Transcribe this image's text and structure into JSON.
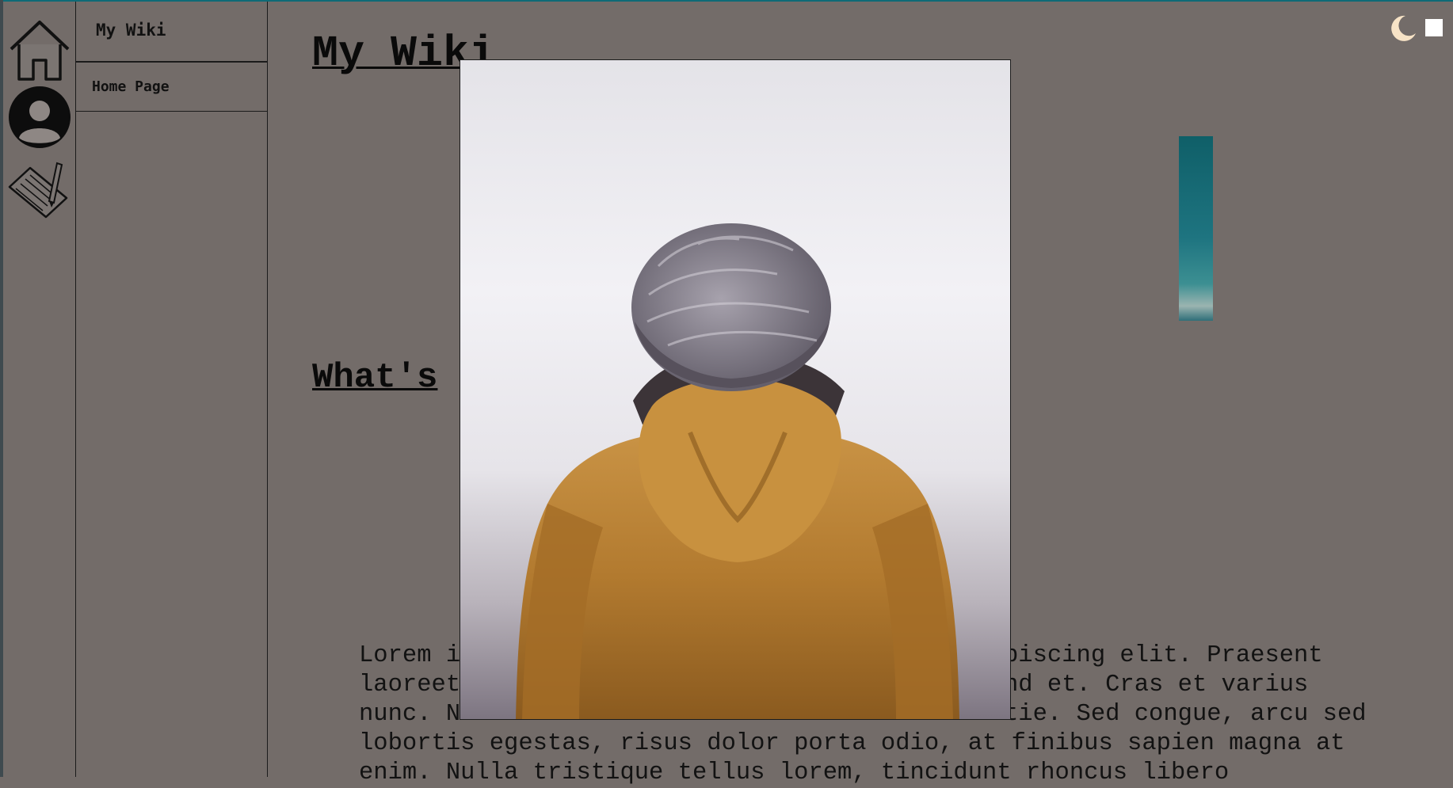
{
  "sidebar": {
    "title": "My Wiki",
    "items": [
      {
        "label": "Home Page"
      }
    ]
  },
  "rail": {
    "icons": [
      "home-icon",
      "user-icon",
      "edit-note-icon"
    ]
  },
  "main": {
    "title": "My Wiki",
    "section_heading": "What's",
    "body_lines": [
      "Lorem i",
      "piscing elit. Praesent",
      "laoreet",
      "nd et. Cras et varius",
      "nunc. N",
      "tie. Sed congue, arcu sed",
      "lobortis egestas, risus dolor porta odio, at finibus sapien magna at",
      "enim. Nulla tristique tellus lorem, tincidunt rhoncus libero"
    ]
  },
  "theme": {
    "toggle_icons": [
      "moon-icon",
      "square-icon"
    ],
    "colors": {
      "background": "#736c69",
      "accent_strip": "#0e6a76",
      "moon": "#f7e3c6",
      "text": "#111111"
    }
  },
  "lightbox": {
    "subject": "person-in-beanie-and-jacket-photo"
  }
}
